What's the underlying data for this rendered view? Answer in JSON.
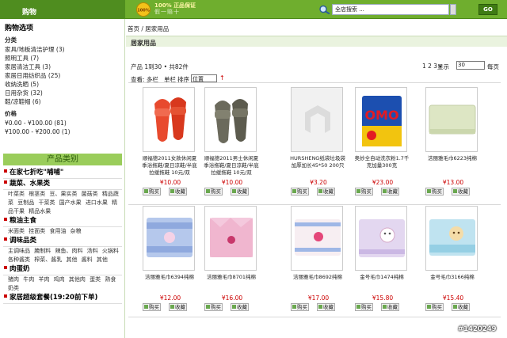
{
  "header": {
    "shop_label": "购物",
    "badge_text": "100%",
    "slogan_line1": "100% 正品保证",
    "slogan_line2": "假一赔十",
    "search_placeholder": "全店搜索 ...",
    "go_label": "GO",
    "colors": {
      "bar": "#6fae2e",
      "accent": "#4f8d1f"
    }
  },
  "sidebar": {
    "options_title": "购物选项",
    "category_heading": "分类",
    "filters": [
      "家具/地板清洁护理 (3)",
      "照明工具 (7)",
      "家居清洁工具 (3)",
      "家居日用纺织品 (25)",
      "收纳洗晒 (5)",
      "日用杂货 (32)",
      "鞋/凉鞋帽 (6)"
    ],
    "price_heading": "价格",
    "prices": [
      "¥0.00 - ¥100.00 (81)",
      "¥100.00 - ¥200.00 (1)"
    ],
    "product_cat_title": "产品类别",
    "categories": [
      {
        "title": "在家七折吃\"哺哺\"",
        "items": ""
      },
      {
        "title": "蔬菜、水果类",
        "items": "叶菜类 根茎类 豆、果实类 菌菇类 精品蔬菜 豆制品 干菜类 国产水果 进口水果 精品干果 精品水果"
      },
      {
        "title": "粮油主食",
        "items": "米面类 挂面类 食用油 杂粮"
      },
      {
        "title": "调味品类",
        "items": "主调味品 腌制料 辣鱼、肉料 汤料 火锅料 各种酱类 榨菜、酱乳 其他 酱料 其他"
      },
      {
        "title": "肉蛋奶",
        "items": "猪肉 牛肉 羊肉 鸡肉 其他肉 蛋类 熟食 奶类"
      },
      {
        "title": "家居超级套餐(19:20前下单)",
        "items": ""
      }
    ]
  },
  "main": {
    "breadcrumb": "首页 / 居家用品",
    "section_title": "居家用品",
    "count_text": "产品 1到30 • 共82件",
    "pages_text": "1 2 3 ▸",
    "show_label": "显示",
    "per_page": "30",
    "per_unit": "每页",
    "view_label": "查看: 多栏",
    "view_single": "单栏",
    "sort_label": "排序",
    "sort_value": "位置",
    "sort_arrow": "↑",
    "buy_label": "购买",
    "fav_label": "收藏"
  },
  "products": [
    {
      "name": "顺福德2011女款休闲夏季浴拖鞋/夏日凉鞋/半底拉缓拖鞋 10元/双",
      "price": "¥10.00",
      "kind": "slipper-red"
    },
    {
      "name": "顺福德2011男士休闲夏季浴拖鞋/夏日凉鞋/半底拉缓拖鞋 10元/双",
      "price": "¥10.00",
      "kind": "slipper-gray"
    },
    {
      "name": "HURSHENG纸袋垃圾袋加厚加长45*50 200只",
      "price": "¥3.20",
      "kind": "placeholder"
    },
    {
      "name": "奥妙全自动洗衣粉1.7千克加量300克",
      "price": "¥23.00",
      "kind": "omo"
    },
    {
      "name": "洁丽雅毛巾6223纯棉",
      "price": "¥13.00",
      "kind": "towel-green"
    },
    {
      "name": "洁丽雅毛巾6394纯棉",
      "price": "¥12.00",
      "kind": "towel-blue"
    },
    {
      "name": "洁丽雅毛巾8701纯棉",
      "price": "¥16.00",
      "kind": "towel-pink"
    },
    {
      "name": "洁丽雅毛巾8692纯棉",
      "price": "¥17.00",
      "kind": "towel-stripe"
    },
    {
      "name": "金号毛巾1474纯棉",
      "price": "¥15.80",
      "kind": "towel-lilac"
    },
    {
      "name": "金号毛巾3166纯棉",
      "price": "¥15.40",
      "kind": "towel-cyan"
    }
  ],
  "watermark": "#1420249"
}
